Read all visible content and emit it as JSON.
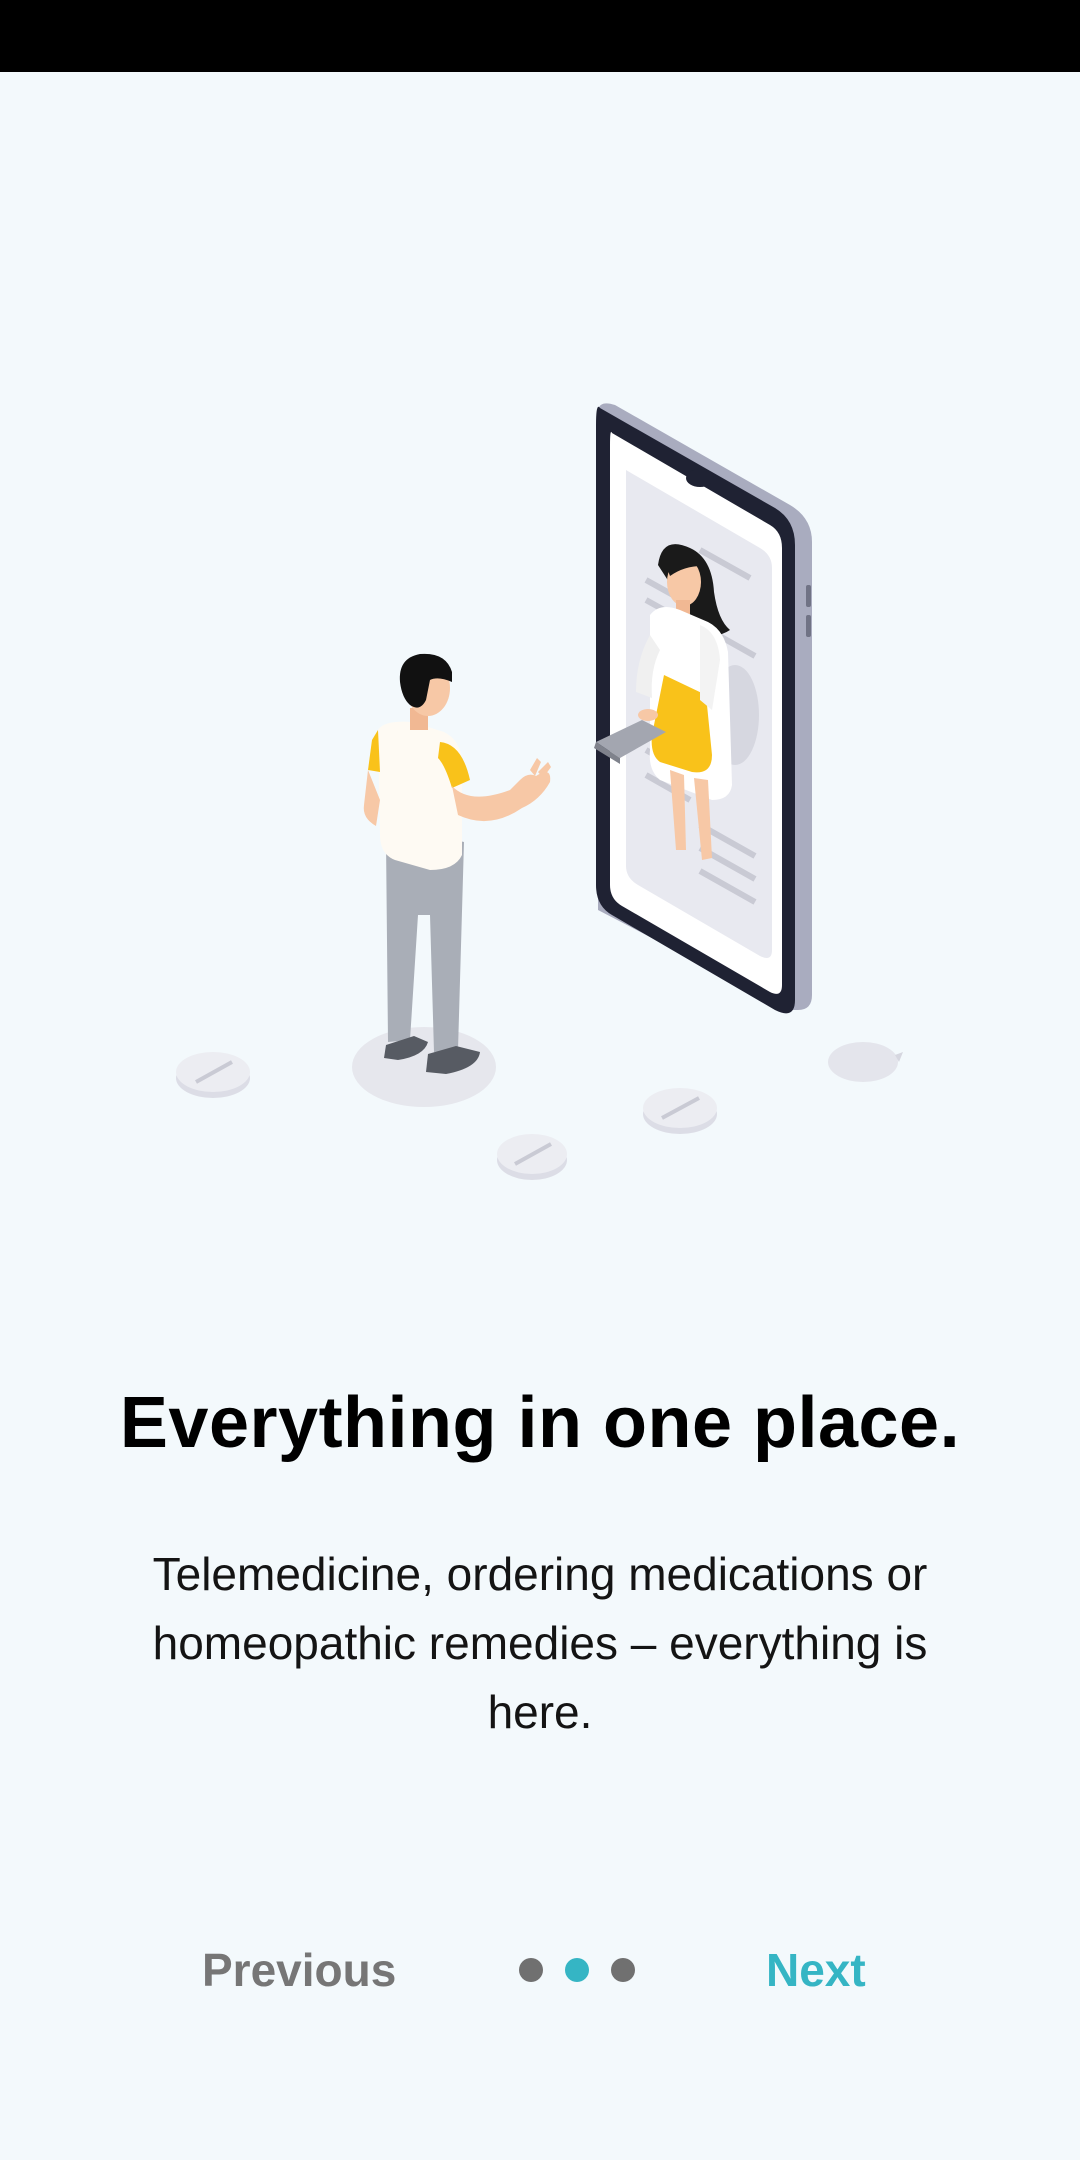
{
  "onboarding": {
    "title": "Everything in one place.",
    "description": "Telemedicine, ordering medications or homeopathic remedies – everything is here.",
    "illustration_icon": "telemedicine-illustration"
  },
  "navigation": {
    "previous_label": "Previous",
    "next_label": "Next",
    "page_count": 3,
    "current_page": 2
  },
  "colors": {
    "background": "#f3f9fc",
    "accent": "#35b5c4",
    "inactive": "#767676",
    "status_bar": "#000000"
  }
}
